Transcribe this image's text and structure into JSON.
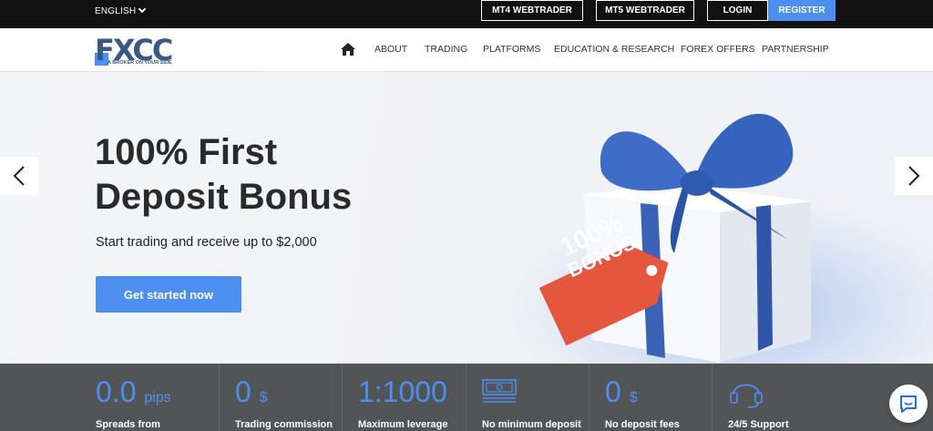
{
  "topbar": {
    "language": "ENGLISH",
    "mt4": "MT4 WEBTRADER",
    "mt5": "MT5 WEBTRADER",
    "login": "LOGIN",
    "register": "REGISTER"
  },
  "logo": {
    "word": "FXCC",
    "tagline": "A BROKER ON YOUR SIDE"
  },
  "nav": {
    "home_icon": "home-icon",
    "items": [
      "ABOUT",
      "TRADING",
      "PLATFORMS",
      "EDUCATION & RESEARCH",
      "FOREX OFFERS",
      "PARTNERSHIP"
    ]
  },
  "hero": {
    "title_line1": "100% First",
    "title_line2": "Deposit Bonus",
    "subtitle": "Start trading and receive up to $2,000",
    "cta": "Get started now",
    "tag_line1": "100%",
    "tag_line2": "BONUS"
  },
  "stats": [
    {
      "value": "0.0",
      "unit": "pips",
      "label": "Spreads from"
    },
    {
      "value": "0",
      "unit": "$",
      "label": "Trading commission"
    },
    {
      "value": "1:1000",
      "unit": "",
      "label": "Maximum leverage"
    },
    {
      "icon": "banknote-icon",
      "label": "No minimum deposit"
    },
    {
      "value": "0",
      "unit": "$",
      "label": "No deposit fees"
    },
    {
      "icon": "headset-icon",
      "label": "24/5 Support"
    }
  ],
  "colors": {
    "accent": "#4c8ff0",
    "topbar": "#111111",
    "stats_bg": "#535456"
  }
}
